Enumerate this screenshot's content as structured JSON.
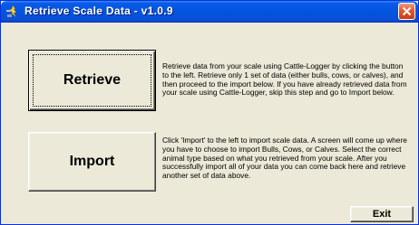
{
  "window": {
    "title": "Retrieve Scale Data - v1.0.9",
    "colors": {
      "titlebar": "#0254e0",
      "client_background": "#ece9d8",
      "close_button": "#e2582f"
    }
  },
  "retrieve": {
    "button_label": "Retrieve",
    "description": "Retrieve data from your scale using Cattle-Logger by clicking the button to the left.  Retrieve only 1 set of data (either bulls, cows, or calves), and then proceed to the import below.  If you have already retrieved data from your scale using Cattle-Logger, skip this step and go to Import below."
  },
  "import": {
    "button_label": "Import",
    "description": "Click 'Import' to the left to import scale data.  A screen will come up where you have to choose to import Bulls, Cows, or Calves.  Select the correct animal type based on what you retrieved from your scale.  After you successfully import all of your data you can come back here and retrieve another set of data above."
  },
  "footer": {
    "exit_label": "Exit"
  },
  "icons": {
    "app": "scale-app-icon",
    "close": "close-icon"
  }
}
